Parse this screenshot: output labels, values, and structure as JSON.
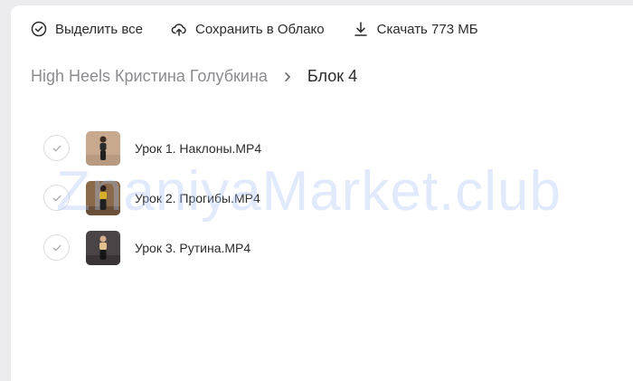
{
  "toolbar": {
    "select_all": {
      "label": "Выделить все",
      "icon": "check-circle-icon"
    },
    "save_cloud": {
      "label": "Сохранить в Облако",
      "icon": "cloud-upload-icon"
    },
    "download": {
      "label": "Скачать 773 МБ",
      "icon": "download-icon"
    }
  },
  "breadcrumb": {
    "parent": "High Heels Кристина Голубкина",
    "separator_icon": "chevron-right-icon",
    "current": "Блок 4"
  },
  "files": [
    {
      "name": "Урок 1. Наклоны.MP4",
      "thumb_bg": "#c9a98e"
    },
    {
      "name": "Урок 2. Прогибы.MP4",
      "thumb_bg": "#8a6a4a"
    },
    {
      "name": "Урок 3. Рутина.MP4",
      "thumb_bg": "#4a4446"
    }
  ],
  "watermark": "ZnaniyaMarket.club",
  "colors": {
    "background": "#ececef",
    "panel": "#ffffff",
    "muted_text": "#8b8b90",
    "text": "#2b2b2b",
    "watermark": "#aac3f5"
  }
}
